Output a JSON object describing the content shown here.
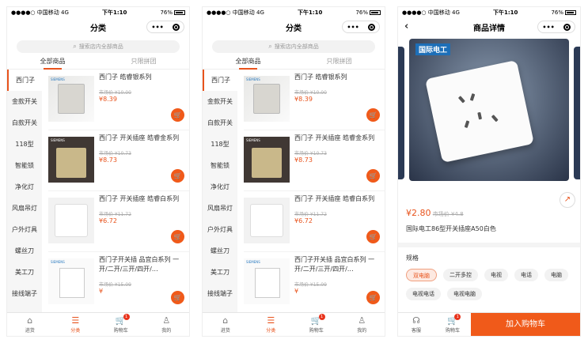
{
  "status": {
    "carrier": "●●●●○ 中国移动",
    "network": "4G",
    "time": "下午1:10",
    "battery": "76%"
  },
  "category_page": {
    "title": "分类",
    "search_placeholder": "搜索店内全部商品",
    "tabs": [
      "全部商品",
      "只限拼团"
    ],
    "sidebar": [
      "西门子",
      "金款开关",
      "白款开关",
      "118型",
      "智能锁",
      "净化灯",
      "风扇吊灯",
      "户外灯具",
      "螺丝刀",
      "美工刀",
      "接线端子"
    ],
    "products": [
      {
        "name": "西门子 皓睿银系列",
        "market_price": "市场价 ¥10.00",
        "price": "¥8.39",
        "thumb": "gray"
      },
      {
        "name": "西门子 开关插座 皓睿金系列",
        "market_price": "市场价 ¥10.73",
        "price": "¥8.73",
        "thumb": "gold"
      },
      {
        "name": "西门子 开关插座 皓睿白系列",
        "market_price": "市场价 ¥11.72",
        "price": "¥6.72",
        "thumb": "white"
      },
      {
        "name": "西门子开关插 品宜白系列 一开/二开/三开/四开/…",
        "market_price": "市场价 ¥15.09",
        "price": "¥",
        "thumb": "panel"
      }
    ]
  },
  "tabbar": [
    {
      "label": "进货",
      "icon": "home-icon"
    },
    {
      "label": "分类",
      "icon": "list-icon"
    },
    {
      "label": "购物车",
      "icon": "cart-icon",
      "badge": "1"
    },
    {
      "label": "我的",
      "icon": "user-icon"
    }
  ],
  "detail_page": {
    "title": "商品详情",
    "brand": "国际电工",
    "price": "¥2.80",
    "market_price": "市场价 ¥4.8",
    "product_title": "国际电工86型开关插座A50白色",
    "spec_label": "规格",
    "specs": [
      "双电脑",
      "二开多控",
      "电视",
      "电话",
      "电脑",
      "电视电话",
      "电视电脑"
    ],
    "selected_spec": "双电脑",
    "service_label": "客服",
    "cart_label": "购物车",
    "cart_badge": "1",
    "add_to_cart": "加入购物车"
  },
  "colors": {
    "accent": "#f05a1a",
    "badge": "#e8331c"
  }
}
